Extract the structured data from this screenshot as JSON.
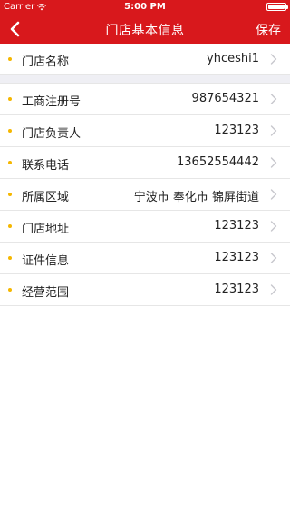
{
  "status_bar": {
    "carrier": "Carrier",
    "time": "5:00 PM",
    "battery_level": 1.0
  },
  "nav": {
    "title": "门店基本信息",
    "save_label": "保存"
  },
  "colors": {
    "brand_red": "#d8181c",
    "bullet": "#f5b700"
  },
  "group1": [
    {
      "label": "门店名称",
      "value": "yhceshi1"
    }
  ],
  "group2": [
    {
      "label": "工商注册号",
      "value": "987654321"
    },
    {
      "label": "门店负责人",
      "value": "123123"
    },
    {
      "label": "联系电话",
      "value": "13652554442"
    },
    {
      "label": "所属区域",
      "value": "宁波市 奉化市 锦屏街道"
    },
    {
      "label": "门店地址",
      "value": "123123"
    },
    {
      "label": "证件信息",
      "value": "123123"
    },
    {
      "label": "经营范围",
      "value": "123123"
    }
  ],
  "icons": {
    "back": "chevron-left-icon",
    "row_arrow": "chevron-right-icon",
    "wifi": "wifi-icon",
    "battery": "battery-icon"
  }
}
